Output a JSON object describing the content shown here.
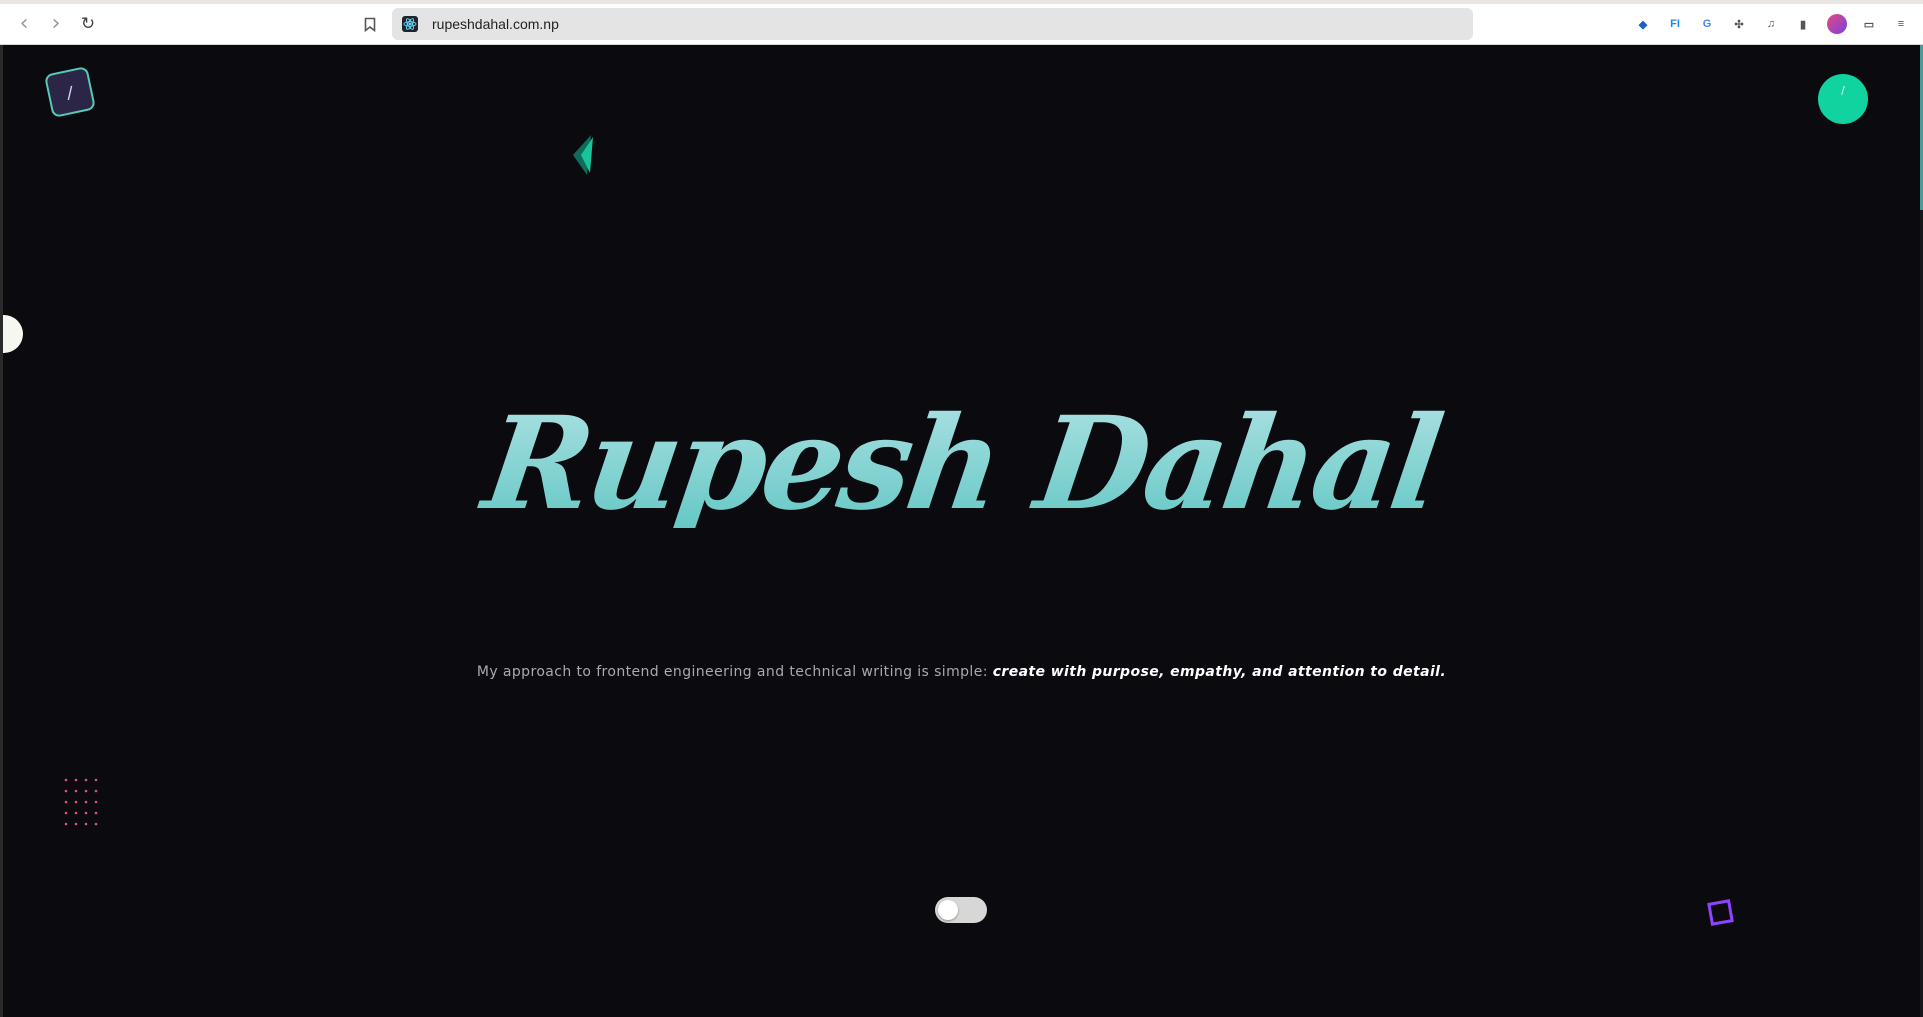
{
  "browser": {
    "url": "rupeshdahal.com.np",
    "nav": {
      "back_icon": "‹",
      "forward_icon": "›",
      "reload_icon": "↻",
      "bookmark_icon": "bookmark"
    },
    "extensions": [
      {
        "name": "bitwarden-icon",
        "glyph": "◆",
        "color": "#1a5fc7"
      },
      {
        "name": "fi-extension-icon",
        "glyph": "FI",
        "color": "#1e88e5"
      },
      {
        "name": "translate-icon",
        "glyph": "G",
        "color": "#4285f4"
      },
      {
        "name": "puzzle-icon",
        "glyph": "✣",
        "color": "#555555"
      },
      {
        "name": "music-icon",
        "glyph": "♫",
        "color": "#555555"
      },
      {
        "name": "sidebar-icon",
        "glyph": "▮",
        "color": "#555555"
      },
      {
        "name": "profile-avatar-icon",
        "glyph": "",
        "color": "#c44cd8"
      },
      {
        "name": "wallet-icon",
        "glyph": "▭",
        "color": "#555555"
      },
      {
        "name": "menu-icon",
        "glyph": "≡",
        "color": "#555555"
      }
    ]
  },
  "page": {
    "logo_glyph": "/",
    "menu_button_glyph": "/",
    "hero_title": "Rupesh Dahal",
    "tagline_plain": "My approach to frontend engineering and technical writing is simple: ",
    "tagline_emphasis": "create with purpose, empathy, and attention to detail.",
    "theme_toggle_state": "off",
    "colors": {
      "background": "#0b0b0f",
      "accent_green": "#10d39f",
      "title_gradient_top": "#a9e0e2",
      "title_gradient_bottom": "#66c8c5",
      "dots": "#e0527a",
      "square": "#8e44ff"
    }
  }
}
